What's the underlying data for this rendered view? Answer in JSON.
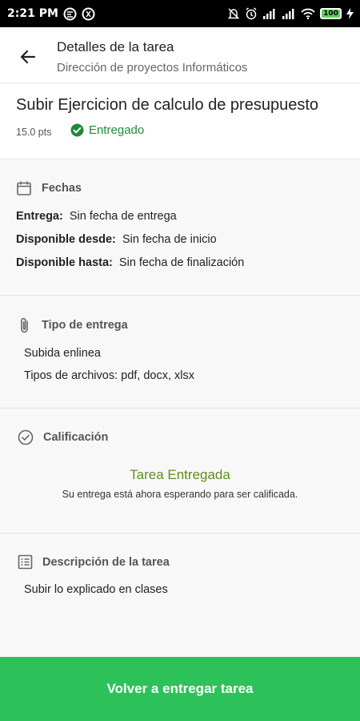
{
  "status_bar": {
    "time": "2:21 PM",
    "battery": "100",
    "left_icons": [
      "notification-icon",
      "notification-icon"
    ],
    "right_icons": [
      "mute-icon",
      "alarm-icon",
      "signal-icon",
      "signal-icon",
      "wifi-icon",
      "battery-icon",
      "charging-icon"
    ]
  },
  "header": {
    "title": "Detalles de la tarea",
    "subtitle": "Dirección de proyectos Informáticos"
  },
  "task": {
    "title": "Subir Ejercicion de calculo de presupuesto",
    "points": "15.0 pts",
    "status": "Entregado",
    "status_color": "#1f8a3b"
  },
  "dates": {
    "heading": "Fechas",
    "rows": [
      {
        "label": "Entrega:",
        "value": "Sin fecha de entrega"
      },
      {
        "label": "Disponible desde:",
        "value": "Sin fecha de inicio"
      },
      {
        "label": "Disponible hasta:",
        "value": "Sin fecha de finalización"
      }
    ]
  },
  "delivery": {
    "heading": "Tipo de entrega",
    "lines": [
      "Subida enlinea",
      "Tipos de archivos: pdf, docx, xlsx"
    ]
  },
  "grading": {
    "heading": "Calificación",
    "title": "Tarea Entregada",
    "message": "Su entrega está ahora esperando para ser calificada."
  },
  "description": {
    "heading": "Descripción de la tarea",
    "text": "Subir lo explicado en clases"
  },
  "footer": {
    "button_label": "Volver a entregar tarea",
    "button_color": "#2dc15a"
  }
}
